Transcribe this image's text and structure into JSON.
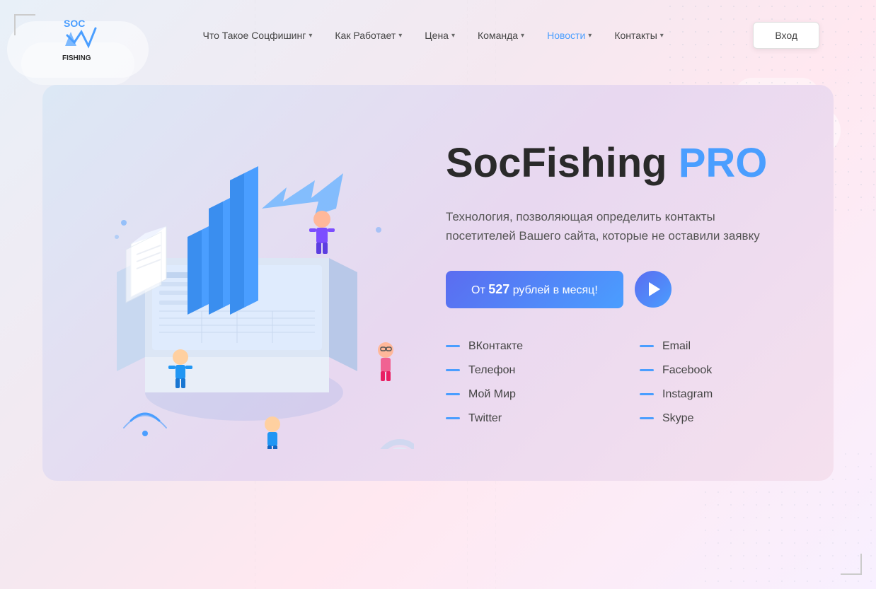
{
  "page": {
    "title": "SocFishing PRO"
  },
  "header": {
    "logo_text": "SOC FISHING",
    "nav_items": [
      {
        "label": "Что Такое Соцфишинг",
        "has_dropdown": true,
        "active": false
      },
      {
        "label": "Как Работает",
        "has_dropdown": true,
        "active": false
      },
      {
        "label": "Цена",
        "has_dropdown": true,
        "active": false
      },
      {
        "label": "Команда",
        "has_dropdown": true,
        "active": false
      },
      {
        "label": "Новости",
        "has_dropdown": true,
        "active": true
      },
      {
        "label": "Контакты",
        "has_dropdown": true,
        "active": false
      }
    ],
    "login_label": "Вход"
  },
  "hero": {
    "title_part1": "SocFishing ",
    "title_part2": "PRO",
    "subtitle": "Технология, позволяющая определить контакты посетителей Вашего сайта, которые не оставили заявку",
    "cta_label_prefix": "От ",
    "cta_price": "527",
    "cta_label_suffix": " рублей в месяц!"
  },
  "features": {
    "col1": [
      {
        "label": "ВКонтакте"
      },
      {
        "label": "Телефон"
      },
      {
        "label": "Мой Мир"
      },
      {
        "label": "Twitter"
      }
    ],
    "col2": [
      {
        "label": "Email"
      },
      {
        "label": "Facebook"
      },
      {
        "label": "Instagram"
      },
      {
        "label": "Skype"
      }
    ]
  }
}
